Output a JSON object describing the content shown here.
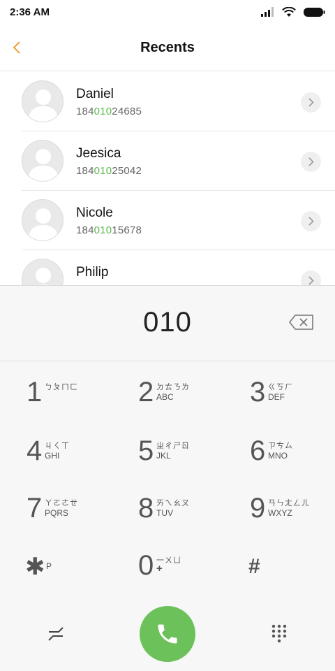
{
  "status": {
    "time": "2:36 AM",
    "icons": [
      "signal-icon",
      "wifi-icon",
      "battery-icon"
    ]
  },
  "header": {
    "title": "Recents",
    "back_icon": "chevron-left-icon",
    "accent": "#f0a030"
  },
  "recents": [
    {
      "name": "Daniel",
      "number_pre": "184",
      "number_match": "010",
      "number_post": "24685"
    },
    {
      "name": "Jeesica",
      "number_pre": "184",
      "number_match": "010",
      "number_post": "25042"
    },
    {
      "name": "Nicole",
      "number_pre": "184",
      "number_match": "010",
      "number_post": "15678"
    },
    {
      "name": "Philip",
      "number_pre": "",
      "number_match": "",
      "number_post": ""
    }
  ],
  "dialer": {
    "input": "010",
    "keys": [
      {
        "num": "1",
        "sub1": "ㄅㄆㄇㄈ",
        "sub2": ""
      },
      {
        "num": "2",
        "sub1": "ㄉㄊㄋㄌ",
        "sub2": "ABC"
      },
      {
        "num": "3",
        "sub1": "ㄍㄎㄏ",
        "sub2": "DEF"
      },
      {
        "num": "4",
        "sub1": "ㄐㄑㄒ",
        "sub2": "GHI"
      },
      {
        "num": "5",
        "sub1": "ㄓㄔㄕㄖ",
        "sub2": "JKL"
      },
      {
        "num": "6",
        "sub1": "ㄗㄘㄙ",
        "sub2": "MNO"
      },
      {
        "num": "7",
        "sub1": "ㄚㄛㄜㄝ",
        "sub2": "PQRS"
      },
      {
        "num": "8",
        "sub1": "ㄞㄟㄠㄡ",
        "sub2": "TUV"
      },
      {
        "num": "9",
        "sub1": "ㄢㄣㄤㄥㄦ",
        "sub2": "WXYZ"
      },
      {
        "num": "✱",
        "sub1": "",
        "sub2": "P"
      },
      {
        "num": "0",
        "sub1": "一ㄨㄩ",
        "sub2": "+"
      },
      {
        "num": "#",
        "sub1": "",
        "sub2": ""
      }
    ],
    "call_color": "#6cc15a",
    "highlight_color": "#5db84f"
  }
}
